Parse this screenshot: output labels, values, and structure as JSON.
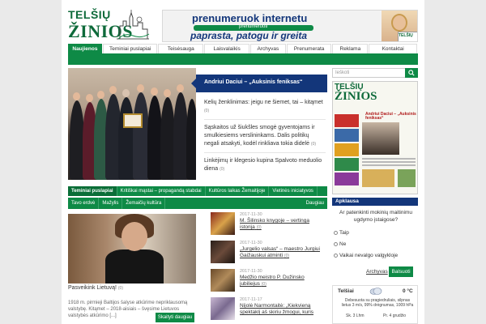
{
  "logo": {
    "line1": "TELŠIŲ",
    "line2": "ŽINIOS"
  },
  "banner": {
    "line1": "prenumeruok internetu",
    "bar_label": "prenumeruoti",
    "line2": "paprasta, patogu ir greita",
    "paper_label": "TELŠIŲ"
  },
  "nav": [
    {
      "label": "Naujienos",
      "active": true
    },
    {
      "label": "Teminiai puslapiai"
    },
    {
      "label": "Teisėsauga"
    },
    {
      "label": "Laisvalaikis"
    },
    {
      "label": "Archyvas"
    },
    {
      "label": "Prenumerata"
    },
    {
      "label": "Reklama"
    },
    {
      "label": "Kontaktai"
    }
  ],
  "hero": {
    "title": "Andriui Daciui – „Auksinis feniksas“",
    "cert_text": ""
  },
  "news": [
    {
      "title": "Kelių ženklinimas: jeigu ne šiemet, tai – kitąmet",
      "count": "(0)"
    },
    {
      "title": "Sąskaitos už šiukšles smogė gyventojams ir smulkiesiems verslininkams. Dalis politikų negali atsakyti, kodėl rinkliava tokia didelė",
      "count": "(0)"
    },
    {
      "title": "Linkėjimų ir klegesio kupina Spalvoto meduolio diena",
      "count": "(0)"
    }
  ],
  "search": {
    "placeholder": "Ieškoti",
    "icon": "search-icon"
  },
  "paper_thumb": {
    "line1": "TELŠIŲ",
    "line2": "ŽINIOS",
    "headline": "Andriui Daciui – „Auksinis feniksas“"
  },
  "categories_row1": [
    {
      "label": "Teminiai puslapiai",
      "active": true
    },
    {
      "label": "Kritiškai mąstai – propagandą stabdai"
    },
    {
      "label": "Kultūros laikas Žemaitijoje"
    },
    {
      "label": "Vietinės iniciatyvos"
    }
  ],
  "categories_row2": [
    {
      "label": "Tavo erdvė"
    },
    {
      "label": "Mažylis"
    },
    {
      "label": "Žemaičių kultūra"
    }
  ],
  "categories_more": "Daugiau",
  "feature": {
    "title": "Pasveikink Lietuvą!",
    "count": "(0)",
    "text": "1918 m. pirmieji Baltijos šalyse atkūrime nepriklausomą valstybę. Kitąmet – 2018-aisiais – švęsime Lietuvos valstybės atkūrimo [...]",
    "more": "Skaityti daugiau"
  },
  "mini_news": [
    {
      "date": "2017-11-30",
      "title": "M. Šilinsko knygoje – vertinga istorija",
      "count": "(0)",
      "color": "#6b2b1e"
    },
    {
      "date": "2017-11-30",
      "title": "„Jurgelio valsas“ – maestro Jurgiui Gaižauskui atminti",
      "count": "(0)",
      "color": "#3a2a22"
    },
    {
      "date": "2017-11-30",
      "title": "Medžio meistro P. Dužinsko jubiliejus",
      "count": "(0)",
      "color": "#7a5a3a"
    },
    {
      "date": "2017-11-17",
      "title": "Nijolė Narmontaitė: „Kiekvieną spektaklį aš skiriu žmogui, kuris",
      "count": "",
      "color": "#9a8aa0"
    }
  ],
  "poll": {
    "header": "Apklausa",
    "question": "Ar patenkinti mokinių maitinimu ugdymo įstaigose?",
    "options": [
      "Taip",
      "Ne",
      "Vaikai nevalgo valgykloje"
    ],
    "archive": "Archyvas",
    "vote": "Balsuoti"
  },
  "weather": {
    "city": "Telšiai",
    "temp": "0 °C",
    "desc": "Debesuota su pragiedruliais, silpnas lietus 3 m/s, 99% drėgnumas, 1009 hPa",
    "days": [
      {
        "day": "Sk. 3",
        "temp": "Lhm"
      },
      {
        "day": "Pr. 4",
        "temp": "grudžio"
      }
    ]
  },
  "colors": {
    "green": "#0e8a46",
    "navy": "#13367a"
  }
}
